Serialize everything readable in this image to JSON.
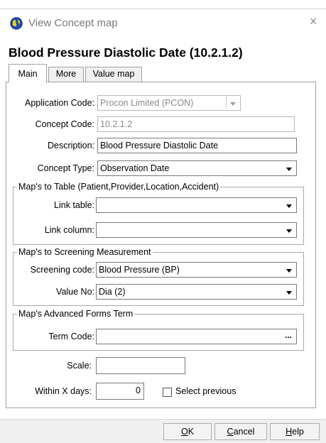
{
  "window": {
    "title": "View Concept map",
    "close_symbol": "×",
    "icon": "globe-icon"
  },
  "heading": "Blood Pressure Diastolic Date (10.2.1.2)",
  "tabs": [
    {
      "label": "Main",
      "active": true
    },
    {
      "label": "More",
      "active": false
    },
    {
      "label": "Value map",
      "active": false
    }
  ],
  "fields": {
    "application_code": {
      "label": "Application Code:",
      "value": "Procon Limited (PCON)"
    },
    "concept_code": {
      "label": "Concept Code:",
      "value": "10.2.1.2"
    },
    "description": {
      "label": "Description:",
      "value": "Blood Pressure Diastolic Date"
    },
    "concept_type": {
      "label": "Concept Type:",
      "value": "Observation Date"
    }
  },
  "group_table": {
    "legend": "Map's to Table (Patient,Provider,Location,Accident)",
    "link_table": {
      "label": "Link table:",
      "value": ""
    },
    "link_column": {
      "label": "Link column:",
      "value": ""
    }
  },
  "group_screening": {
    "legend": "Map's to Screening Measurement",
    "screening_code": {
      "label": "Screening code:",
      "value": "Blood Pressure (BP)"
    },
    "value_no": {
      "label": "Value No:",
      "value": "Dia (2)"
    }
  },
  "group_forms": {
    "legend": "Map's Advanced Forms Term",
    "term_code": {
      "label": "Term Code:",
      "value": "",
      "button": "..."
    }
  },
  "scale": {
    "label": "Scale:",
    "value": ""
  },
  "within_days": {
    "label": "Within X days:",
    "value": "0"
  },
  "select_previous": {
    "label": "Select previous",
    "checked": false
  },
  "buttons": {
    "ok": {
      "mnemonic": "O",
      "rest": "K"
    },
    "cancel": {
      "mnemonic": "C",
      "rest": "ancel"
    },
    "help": {
      "mnemonic": "H",
      "rest": "elp"
    }
  }
}
